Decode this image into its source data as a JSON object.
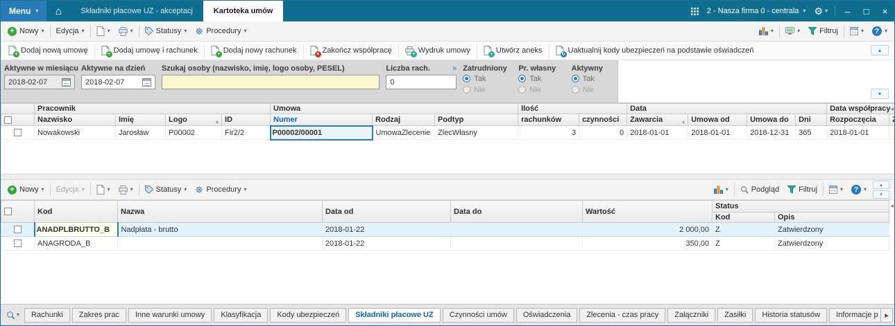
{
  "icons": {
    "plus": "+",
    "close_badge": "×",
    "refresh": "↻",
    "chevron_down": "▾",
    "chevron_up": "▴",
    "arrow_left": "◂",
    "arrow_right": "▸",
    "sort_asc": "▴",
    "home": "⌂",
    "gear": "⚙",
    "minimize": "–",
    "maximize": "□",
    "close": "×",
    "question": "?",
    "more": "»"
  },
  "colors": {
    "titlebar": "#0f6e90",
    "accent_blue": "#2a7cb8",
    "sorted_column": "#1464a0",
    "selected_row": "#e3f1fb",
    "search_yellow": "#fbf6cf",
    "funnel_green": "#2da89c"
  },
  "titlebar": {
    "menu": "Menu",
    "tab_inactive": "Składniki płacowe UZ - akceptacj",
    "tab_active": "Kartoteka umów",
    "company": "2 - Nasza firma 0 - centrala"
  },
  "toolbar_top": {
    "nowy": "Nowy",
    "edycja": "Edycja",
    "statusy": "Statusy",
    "procedury": "Procedury",
    "filtruj": "Filtruj"
  },
  "actionbar": {
    "dodaj_nowa_umowe": "Dodaj nową umowę",
    "dodaj_umowe_i_rachunek": "Dodaj umowę i rachunek",
    "dodaj_nowy_rachunek": "Dodaj nowy rachunek",
    "zakoncz_wspolprace": "Zakończ współpracę",
    "wydruk_umowy": "Wydruk umowy",
    "utworz_aneks": "Utwórz aneks",
    "uaktualnij": "Uaktualnij kody ubezpieczeń na podstawie oświadczeń"
  },
  "filters": {
    "aktywne_w_miesiacu": {
      "label": "Aktywne w miesiącu",
      "value": "2018-02-07"
    },
    "aktywne_na_dzien": {
      "label": "Aktywne na dzień",
      "value": "2018-02-07"
    },
    "szukaj": {
      "label": "Szukaj osoby (nazwisko, imię, logo osoby, PESEL)",
      "value": ""
    },
    "liczba_rach": {
      "label": "Liczba rach.",
      "value": "0"
    },
    "zatrudniony": {
      "label": "Zatrudniony",
      "tak": "Tak",
      "nie": "Nie",
      "selected": "Tak"
    },
    "pr_wlasny": {
      "label": "Pr. własny",
      "tak": "Tak",
      "nie": "Nie",
      "selected": "Tak"
    },
    "aktywny": {
      "label": "Aktywny",
      "tak": "Tak",
      "nie": "Nie",
      "selected": "Tak"
    }
  },
  "contracts": {
    "groups": {
      "pracownik": "Pracownik",
      "umowa": "Umowa",
      "ilosc": "Ilość",
      "data": "Data",
      "data_wspolpracy": "Data współpracy"
    },
    "columns": {
      "nazwisko": "Nazwisko",
      "imie": "Imię",
      "logo": "Logo",
      "id": "ID",
      "numer": "Numer",
      "rodzaj": "Rodzaj",
      "podtyp": "Podtyp",
      "rachunkow": "rachunków",
      "czynnosci": "czynności",
      "zawarcia": "Zawarcia",
      "umowa_od": "Umowa od",
      "umowa_do": "Umowa do",
      "dni": "Dni",
      "rozpoczecia": "Rozpoczęcia",
      "zakonczenia": "Zakończen"
    },
    "rows": [
      {
        "nazwisko": "Nowakowski",
        "imie": "Jarosław",
        "logo": "P00002",
        "id": "Fir2/2",
        "numer": "P00002/00001",
        "rodzaj": "UmowaZlecenie",
        "podtyp": "ZlecWłasny",
        "rachunkow": "3",
        "czynnosci": "0",
        "zawarcia": "2018-01-01",
        "umowa_od": "2018-01-01",
        "umowa_do": "2018-12-31",
        "dni": "365",
        "rozpoczecia": "2018-01-01",
        "zakonczenia": ""
      }
    ]
  },
  "toolbar_bottom": {
    "nowy": "Nowy",
    "edycja": "Edycja",
    "statusy": "Statusy",
    "procedury": "Procedury",
    "podglad": "Podgląd",
    "filtruj": "Filtruj"
  },
  "components": {
    "columns": {
      "kod": "Kod",
      "nazwa": "Nazwa",
      "data_od": "Data od",
      "data_do": "Data do",
      "wartosc": "Wartość",
      "status": "Status",
      "status_kod": "Kod",
      "status_opis": "Opis"
    },
    "rows": [
      {
        "kod": "ANADPLBRUTTO_B",
        "nazwa": "Nadpłata - brutto",
        "data_od": "2018-01-22",
        "data_do": "",
        "wartosc": "2 000,00",
        "status_kod": "Z",
        "status_opis": "Zatwierdzony"
      },
      {
        "kod": "ANAGRODA_B",
        "nazwa": "",
        "data_od": "2018-01-22",
        "data_do": "",
        "wartosc": "350,00",
        "status_kod": "Z",
        "status_opis": "Zatwierdzony"
      }
    ]
  },
  "bottom_tabs": {
    "tabs": [
      "Rachunki",
      "Zakres prac",
      "Inne warunki umowy",
      "Klasyfikacja",
      "Kody ubezpieczeń",
      "Składniki płacowe UZ",
      "Czynności umów",
      "Oświadczenia",
      "Zlecenia - czas pracy",
      "Załączniki",
      "Zasiłki",
      "Historia statusów",
      "Informacje p"
    ],
    "active": "Składniki płacowe UZ"
  }
}
